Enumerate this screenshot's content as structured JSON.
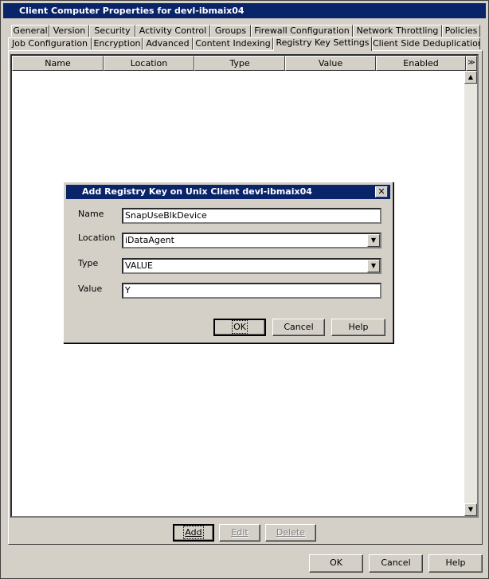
{
  "window": {
    "title": "Client Computer Properties for devl-ibmaix04"
  },
  "tabs_row1": [
    "General",
    "Version",
    "Security",
    "Activity Control",
    "Groups",
    "Firewall Configuration",
    "Network Throttling",
    "Policies"
  ],
  "tabs_row2": [
    "Job Configuration",
    "Encryption",
    "Advanced",
    "Content Indexing",
    "Registry Key Settings",
    "Client Side Deduplication"
  ],
  "active_tab": "Registry Key Settings",
  "table": {
    "columns": [
      "Name",
      "Location",
      "Type",
      "Value",
      "Enabled"
    ],
    "rows": []
  },
  "list_buttons": {
    "add": "Add",
    "edit": "Edit",
    "delete": "Delete"
  },
  "dialog": {
    "title": "Add Registry Key on Unix Client  devl-ibmaix04",
    "name_label": "Name",
    "name_value": "SnapUseBlkDevice",
    "location_label": "Location",
    "location_value": "iDataAgent",
    "type_label": "Type",
    "type_value": "VALUE",
    "value_label": "Value",
    "value_value": "Y",
    "ok": "OK",
    "cancel": "Cancel",
    "help": "Help"
  },
  "footer": {
    "ok": "OK",
    "cancel": "Cancel",
    "help": "Help"
  }
}
